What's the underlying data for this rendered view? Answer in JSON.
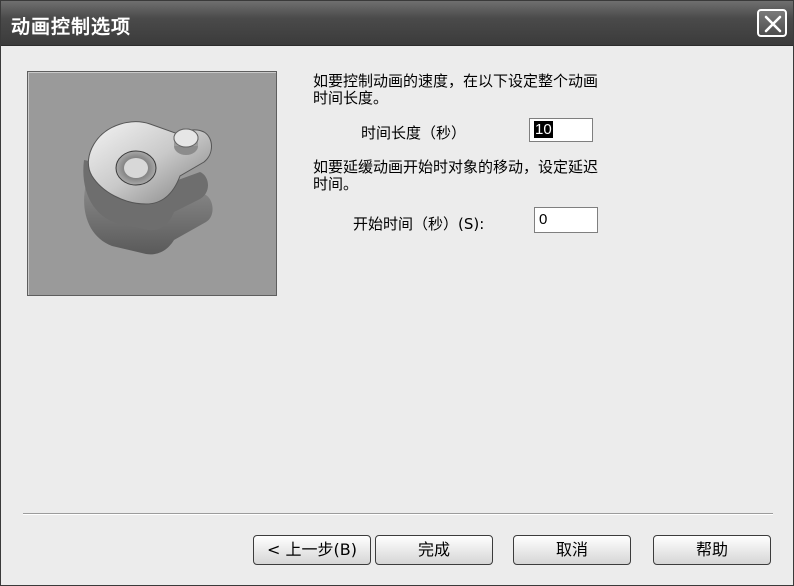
{
  "window": {
    "title": "动画控制选项",
    "close_icon": "close-icon"
  },
  "preview": {
    "image": "mechanical-part-preview"
  },
  "duration": {
    "description_line1": "如要控制动画的速度，在以下设定整个动画",
    "description_line2": "时间长度。",
    "label": "时间长度（秒）",
    "value": "10"
  },
  "delay": {
    "description_line1": "如要延缓动画开始时对象的移动，设定延迟",
    "description_line2": "时间。",
    "label": "开始时间（秒）(S):",
    "value": "0"
  },
  "buttons": {
    "back": "< 上一步(B)",
    "finish": "完成",
    "cancel": "取消",
    "help": "帮助"
  }
}
